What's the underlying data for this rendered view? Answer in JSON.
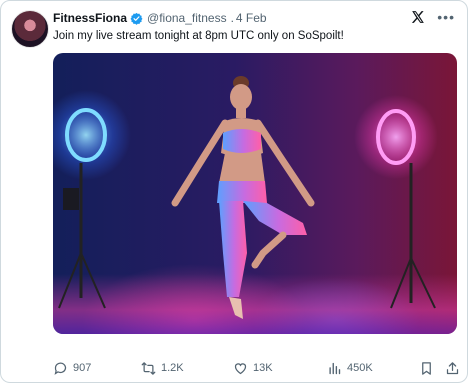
{
  "post": {
    "display_name": "FitnessFiona",
    "handle": "@fiona_fitness",
    "separator": ".",
    "date": "4 Feb",
    "text": "Join my live stream tonight at 8pm UTC only on SoSpoilt!",
    "verified": true
  },
  "actions": {
    "replies": "907",
    "reposts": "1.2K",
    "likes": "13K",
    "views": "450K"
  },
  "colors": {
    "verified": "#1d9bf0",
    "text": "#0f1419",
    "muted": "#536471"
  },
  "icons": [
    "verified-icon",
    "x-logo-icon",
    "more-icon",
    "reply-icon",
    "retweet-icon",
    "like-icon",
    "views-icon",
    "bookmark-icon",
    "share-icon"
  ]
}
